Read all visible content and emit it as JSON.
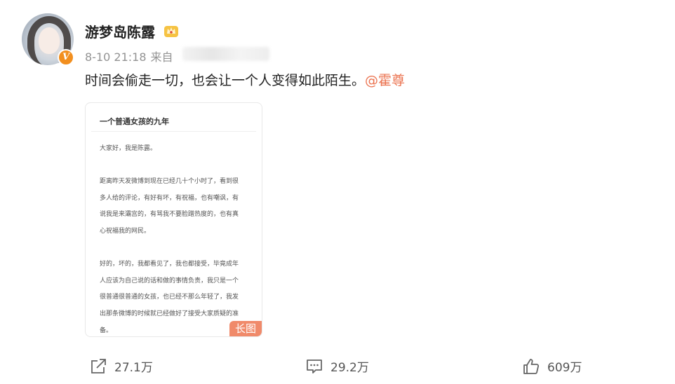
{
  "post": {
    "username": "游梦岛陈露",
    "timestamp": "8-10 21:18",
    "source_prefix": "来自",
    "text": "时间会偷走一切，也会让一个人变得如此陌生。",
    "mention": "@霍尊",
    "verified_badge": "V"
  },
  "card": {
    "title": "一个普通女孩的九年",
    "lines": [
      "大家好，我是陈露。",
      "",
      "距离昨天发微博到现在已经几十个小时了，看到很",
      "多人给的评论，有好有坏，有祝福，也有嘲讽，有",
      "说我是来灞宫的，有骂我不要脸蹭热度的，也有真",
      "心祝福我的网民。",
      "",
      "好的，坏的，我都看见了，我也都接受，毕竟成年",
      "人应该为自己说的话和做的事情负责，我只是一个",
      "很普通很普通的女孩，也已经不那么年轻了，我发",
      "出那条微博的时候就已经做好了接受大家质疑的准",
      "备。"
    ],
    "badge": "长图"
  },
  "actions": {
    "share": "27.1万",
    "comment": "29.2万",
    "like": "609万"
  },
  "colors": {
    "mention": "#eb7350",
    "badge": "#f08a6a",
    "verified": "#f28f1f"
  }
}
